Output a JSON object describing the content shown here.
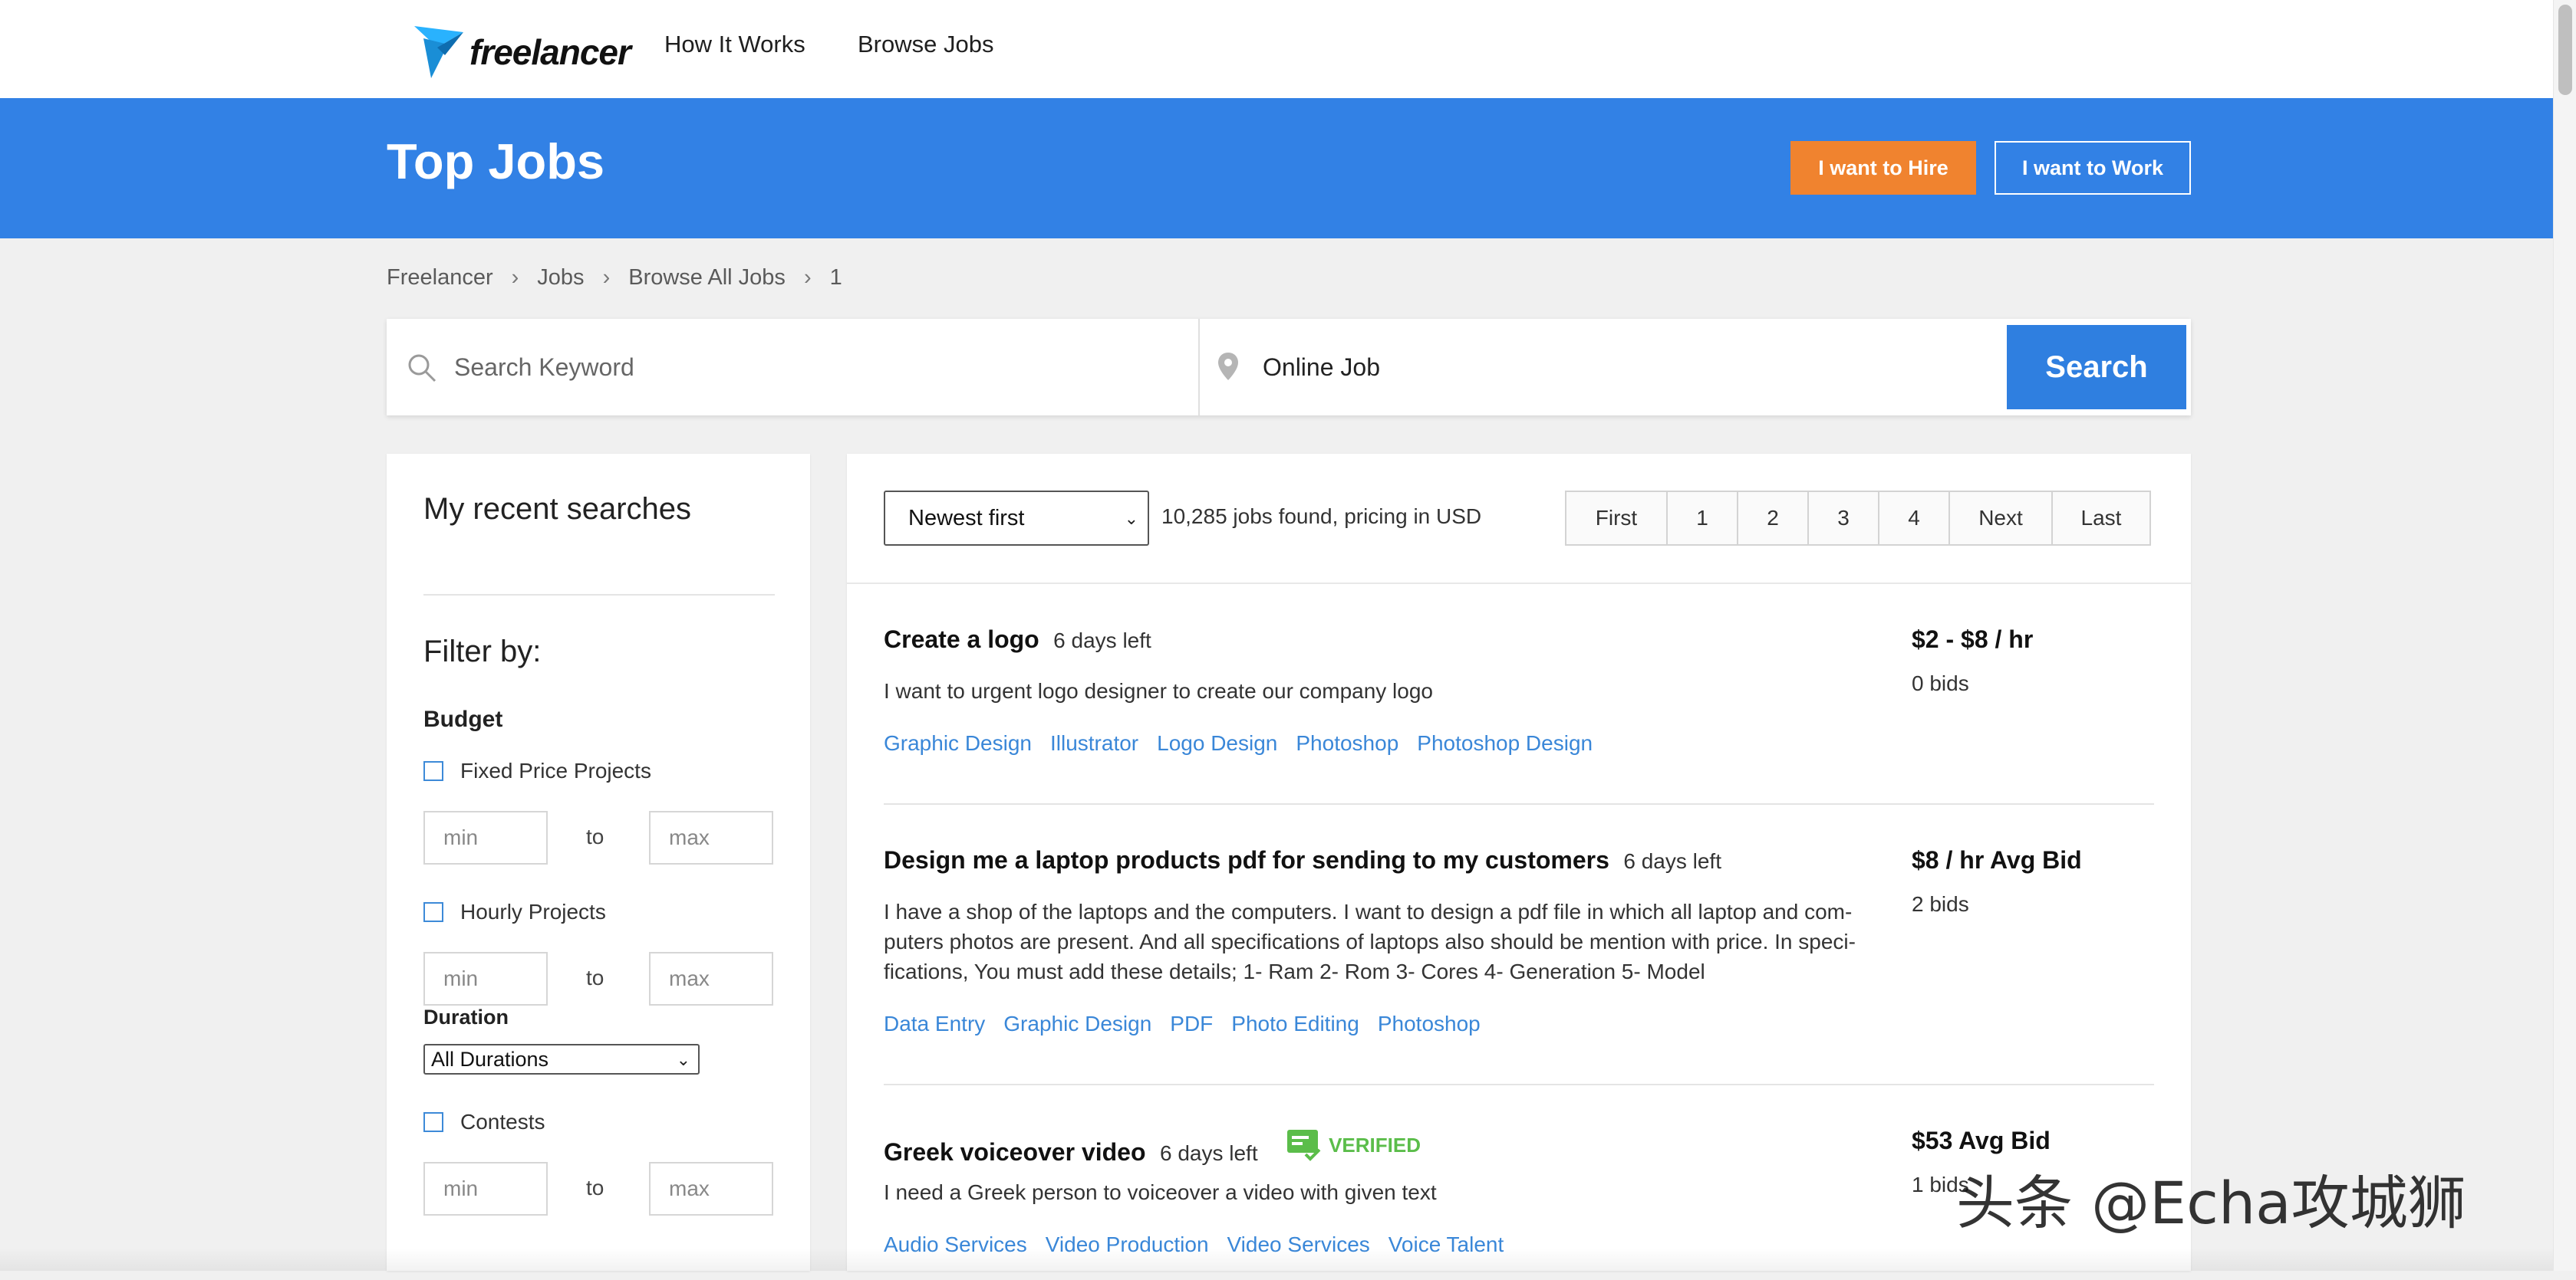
{
  "header": {
    "logo_text": "freelancer",
    "nav": [
      {
        "label": "How It Works"
      },
      {
        "label": "Browse Jobs"
      }
    ]
  },
  "hero": {
    "title": "Top Jobs",
    "hire_label": "I want to Hire",
    "work_label": "I want to Work"
  },
  "breadcrumb": [
    "Freelancer",
    "Jobs",
    "Browse All Jobs",
    "1"
  ],
  "breadcrumb_separator": "›",
  "search": {
    "keyword_placeholder": "Search Keyword",
    "location_value": "Online Job",
    "button_label": "Search"
  },
  "sidebar": {
    "recent_heading": "My recent searches",
    "filter_heading": "Filter by:",
    "budget_heading": "Budget",
    "fixed_label": "Fixed Price Projects",
    "hourly_label": "Hourly Projects",
    "duration_heading": "Duration",
    "duration_selected": "All Durations",
    "contests_label": "Contests",
    "min_placeholder": "min",
    "max_placeholder": "max",
    "to_label": "to"
  },
  "results": {
    "sort_selected": "Newest first",
    "summary": "10,285 jobs found, pricing in USD",
    "pagination": [
      "First",
      "1",
      "2",
      "3",
      "4",
      "Next",
      "Last"
    ]
  },
  "jobs": [
    {
      "title": "Create a logo",
      "days_left": "6 days left",
      "description": "I want to urgent logo designer to create our company logo",
      "tags": [
        "Graphic Design",
        "Illustrator",
        "Logo Design",
        "Photoshop",
        "Photoshop Design"
      ],
      "price": "$2 - $8 / hr",
      "bids": "0 bids"
    },
    {
      "title": "Design me a laptop products pdf for sending to my customers",
      "days_left": "6 days left",
      "description_lines": [
        "I have a shop of the laptops and the computers. I want to design a pdf file in which all laptop and com-",
        "puters photos are present. And all specifications of laptops also should be mention with price. In speci-",
        "fications, You must add these details; 1- Ram 2- Rom 3- Cores 4- Generation 5- Model"
      ],
      "tags": [
        "Data Entry",
        "Graphic Design",
        "PDF",
        "Photo Editing",
        "Photoshop"
      ],
      "price": "$8 / hr Avg Bid",
      "bids": "2 bids"
    },
    {
      "title": "Greek voiceover video",
      "days_left": "6 days left",
      "verified_label": "VERIFIED",
      "description": "I need a Greek person to voiceover a video with given text",
      "tags": [
        "Audio Services",
        "Video Production",
        "Video Services",
        "Voice Talent"
      ],
      "price": "$53 Avg Bid",
      "bids": "1 bids"
    }
  ],
  "watermark": "头条 @Echa攻城狮",
  "colors": {
    "brand_blue": "#3281e5",
    "hire_orange": "#f0832f",
    "link_blue": "#3a87d8",
    "verified_green": "#5bbd4a",
    "search_button": "#2f7fe0"
  },
  "icons": [
    "freelancer-bird-logo",
    "search-icon",
    "location-pin-icon",
    "chevron-down-icon",
    "verified-badge-icon"
  ]
}
